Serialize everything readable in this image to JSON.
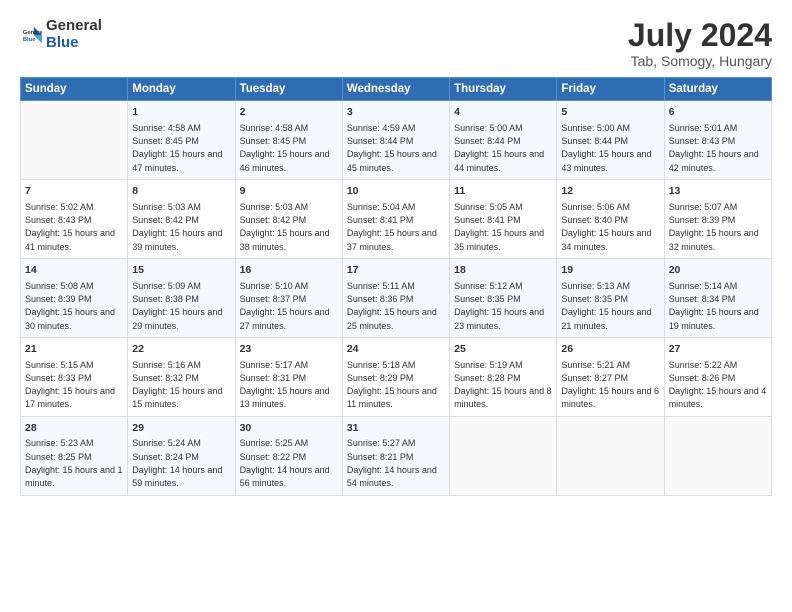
{
  "header": {
    "logo_general": "General",
    "logo_blue": "Blue",
    "title": "July 2024",
    "subtitle": "Tab, Somogy, Hungary"
  },
  "weekdays": [
    "Sunday",
    "Monday",
    "Tuesday",
    "Wednesday",
    "Thursday",
    "Friday",
    "Saturday"
  ],
  "weeks": [
    [
      {
        "day": "",
        "sunrise": "",
        "sunset": "",
        "daylight": ""
      },
      {
        "day": "1",
        "sunrise": "Sunrise: 4:58 AM",
        "sunset": "Sunset: 8:45 PM",
        "daylight": "Daylight: 15 hours and 47 minutes."
      },
      {
        "day": "2",
        "sunrise": "Sunrise: 4:58 AM",
        "sunset": "Sunset: 8:45 PM",
        "daylight": "Daylight: 15 hours and 46 minutes."
      },
      {
        "day": "3",
        "sunrise": "Sunrise: 4:59 AM",
        "sunset": "Sunset: 8:44 PM",
        "daylight": "Daylight: 15 hours and 45 minutes."
      },
      {
        "day": "4",
        "sunrise": "Sunrise: 5:00 AM",
        "sunset": "Sunset: 8:44 PM",
        "daylight": "Daylight: 15 hours and 44 minutes."
      },
      {
        "day": "5",
        "sunrise": "Sunrise: 5:00 AM",
        "sunset": "Sunset: 8:44 PM",
        "daylight": "Daylight: 15 hours and 43 minutes."
      },
      {
        "day": "6",
        "sunrise": "Sunrise: 5:01 AM",
        "sunset": "Sunset: 8:43 PM",
        "daylight": "Daylight: 15 hours and 42 minutes."
      }
    ],
    [
      {
        "day": "7",
        "sunrise": "Sunrise: 5:02 AM",
        "sunset": "Sunset: 8:43 PM",
        "daylight": "Daylight: 15 hours and 41 minutes."
      },
      {
        "day": "8",
        "sunrise": "Sunrise: 5:03 AM",
        "sunset": "Sunset: 8:42 PM",
        "daylight": "Daylight: 15 hours and 39 minutes."
      },
      {
        "day": "9",
        "sunrise": "Sunrise: 5:03 AM",
        "sunset": "Sunset: 8:42 PM",
        "daylight": "Daylight: 15 hours and 38 minutes."
      },
      {
        "day": "10",
        "sunrise": "Sunrise: 5:04 AM",
        "sunset": "Sunset: 8:41 PM",
        "daylight": "Daylight: 15 hours and 37 minutes."
      },
      {
        "day": "11",
        "sunrise": "Sunrise: 5:05 AM",
        "sunset": "Sunset: 8:41 PM",
        "daylight": "Daylight: 15 hours and 35 minutes."
      },
      {
        "day": "12",
        "sunrise": "Sunrise: 5:06 AM",
        "sunset": "Sunset: 8:40 PM",
        "daylight": "Daylight: 15 hours and 34 minutes."
      },
      {
        "day": "13",
        "sunrise": "Sunrise: 5:07 AM",
        "sunset": "Sunset: 8:39 PM",
        "daylight": "Daylight: 15 hours and 32 minutes."
      }
    ],
    [
      {
        "day": "14",
        "sunrise": "Sunrise: 5:08 AM",
        "sunset": "Sunset: 8:39 PM",
        "daylight": "Daylight: 15 hours and 30 minutes."
      },
      {
        "day": "15",
        "sunrise": "Sunrise: 5:09 AM",
        "sunset": "Sunset: 8:38 PM",
        "daylight": "Daylight: 15 hours and 29 minutes."
      },
      {
        "day": "16",
        "sunrise": "Sunrise: 5:10 AM",
        "sunset": "Sunset: 8:37 PM",
        "daylight": "Daylight: 15 hours and 27 minutes."
      },
      {
        "day": "17",
        "sunrise": "Sunrise: 5:11 AM",
        "sunset": "Sunset: 8:36 PM",
        "daylight": "Daylight: 15 hours and 25 minutes."
      },
      {
        "day": "18",
        "sunrise": "Sunrise: 5:12 AM",
        "sunset": "Sunset: 8:35 PM",
        "daylight": "Daylight: 15 hours and 23 minutes."
      },
      {
        "day": "19",
        "sunrise": "Sunrise: 5:13 AM",
        "sunset": "Sunset: 8:35 PM",
        "daylight": "Daylight: 15 hours and 21 minutes."
      },
      {
        "day": "20",
        "sunrise": "Sunrise: 5:14 AM",
        "sunset": "Sunset: 8:34 PM",
        "daylight": "Daylight: 15 hours and 19 minutes."
      }
    ],
    [
      {
        "day": "21",
        "sunrise": "Sunrise: 5:15 AM",
        "sunset": "Sunset: 8:33 PM",
        "daylight": "Daylight: 15 hours and 17 minutes."
      },
      {
        "day": "22",
        "sunrise": "Sunrise: 5:16 AM",
        "sunset": "Sunset: 8:32 PM",
        "daylight": "Daylight: 15 hours and 15 minutes."
      },
      {
        "day": "23",
        "sunrise": "Sunrise: 5:17 AM",
        "sunset": "Sunset: 8:31 PM",
        "daylight": "Daylight: 15 hours and 13 minutes."
      },
      {
        "day": "24",
        "sunrise": "Sunrise: 5:18 AM",
        "sunset": "Sunset: 8:29 PM",
        "daylight": "Daylight: 15 hours and 11 minutes."
      },
      {
        "day": "25",
        "sunrise": "Sunrise: 5:19 AM",
        "sunset": "Sunset: 8:28 PM",
        "daylight": "Daylight: 15 hours and 8 minutes."
      },
      {
        "day": "26",
        "sunrise": "Sunrise: 5:21 AM",
        "sunset": "Sunset: 8:27 PM",
        "daylight": "Daylight: 15 hours and 6 minutes."
      },
      {
        "day": "27",
        "sunrise": "Sunrise: 5:22 AM",
        "sunset": "Sunset: 8:26 PM",
        "daylight": "Daylight: 15 hours and 4 minutes."
      }
    ],
    [
      {
        "day": "28",
        "sunrise": "Sunrise: 5:23 AM",
        "sunset": "Sunset: 8:25 PM",
        "daylight": "Daylight: 15 hours and 1 minute."
      },
      {
        "day": "29",
        "sunrise": "Sunrise: 5:24 AM",
        "sunset": "Sunset: 8:24 PM",
        "daylight": "Daylight: 14 hours and 59 minutes."
      },
      {
        "day": "30",
        "sunrise": "Sunrise: 5:25 AM",
        "sunset": "Sunset: 8:22 PM",
        "daylight": "Daylight: 14 hours and 56 minutes."
      },
      {
        "day": "31",
        "sunrise": "Sunrise: 5:27 AM",
        "sunset": "Sunset: 8:21 PM",
        "daylight": "Daylight: 14 hours and 54 minutes."
      },
      {
        "day": "",
        "sunrise": "",
        "sunset": "",
        "daylight": ""
      },
      {
        "day": "",
        "sunrise": "",
        "sunset": "",
        "daylight": ""
      },
      {
        "day": "",
        "sunrise": "",
        "sunset": "",
        "daylight": ""
      }
    ]
  ]
}
